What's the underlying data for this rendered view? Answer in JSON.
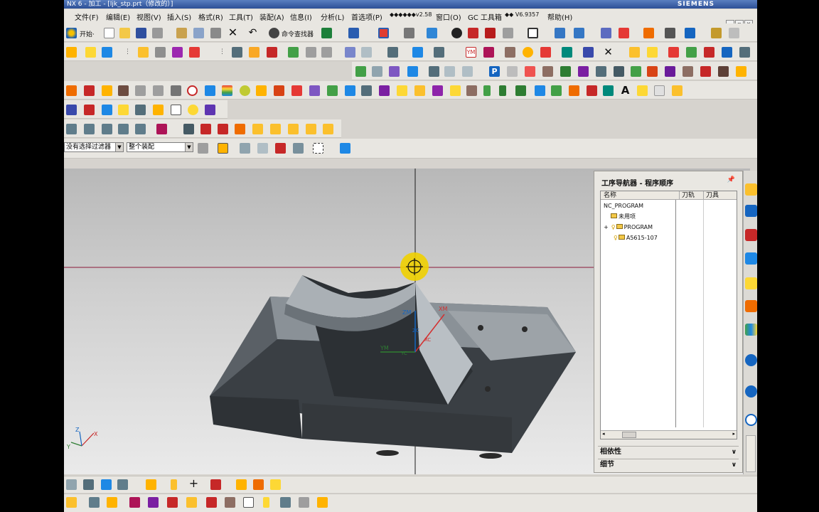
{
  "window": {
    "title": "NX 6 - 加工 - [ljk_stp.prt（修改的）]",
    "brand": "SIEMENS"
  },
  "menubar": {
    "items": [
      "文件(F)",
      "编辑(E)",
      "视图(V)",
      "插入(S)",
      "格式(R)",
      "工具(T)",
      "装配(A)",
      "信息(I)",
      "分析(L)",
      "首选项(P)",
      "◆◆◆◆◆◆v2.58",
      "窗口(O)",
      "GC 工具箱",
      "◆◆ V6.9357",
      "帮助(H)"
    ]
  },
  "toolbar": {
    "start_label": "开始·",
    "command_finder_label": "命令查找器"
  },
  "filter_bar": {
    "selection_filter": "没有选择过滤器",
    "scope": "整个装配"
  },
  "operation_navigator": {
    "title": "工序导航器 - 程序顺序",
    "columns": [
      "名称",
      "刀轨",
      "刀具"
    ],
    "tree": [
      {
        "label": "NC_PROGRAM",
        "level": 0
      },
      {
        "label": "未用项",
        "level": 1
      },
      {
        "label": "PROGRAM",
        "level": 1
      },
      {
        "label": "A5615-107",
        "level": 1
      }
    ],
    "sections": [
      "相依性",
      "细节"
    ]
  },
  "viewport": {
    "wcs_labels": [
      "XM",
      "YM",
      "ZM",
      "XC",
      "YC",
      "ZC"
    ],
    "triad_labels": [
      "X",
      "Y",
      "Z"
    ]
  },
  "colors": {
    "accent": "#2c4f96",
    "selection": "#f0d000",
    "part": "#7b8288"
  }
}
